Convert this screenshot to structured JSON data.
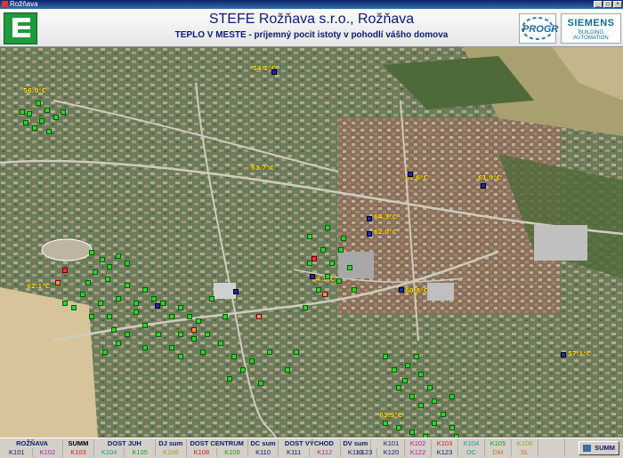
{
  "window": {
    "title": "Rožňava"
  },
  "header": {
    "title": "STEFE Rožňava s.r.o., Rožňava",
    "subtitle": "TEPLO V MESTE - príjemný pocit istoty v pohodlí vášho domova",
    "logo_left": "E",
    "logo_mid": "PROGR",
    "logo_right_brand": "SIEMENS",
    "logo_right_sub": "BUILDING AUTOMATION"
  },
  "map": {
    "labels": [
      {
        "text": "56.0°C"
      },
      {
        "text": "54.2°C"
      },
      {
        "text": "63.7°C"
      },
      {
        "text": "62.6°C"
      },
      {
        "text": "61.9°C"
      },
      {
        "text": "64.3°C"
      },
      {
        "text": "62.0°C"
      },
      {
        "text": "64.1°C"
      },
      {
        "text": "60.8°C"
      },
      {
        "text": "57.1°C"
      },
      {
        "text": "63.5°C"
      },
      {
        "text": "62.1°C"
      }
    ]
  },
  "nav": {
    "row1": [
      "ROŽŇAVA",
      "",
      "SUMM",
      "DOST JUH",
      "DJ sum",
      "DOST CENTRUM",
      "DC sum",
      "DOST VÝCHOD",
      "DV sum"
    ],
    "row2": [
      "K101",
      "K102",
      "K103",
      "K104",
      "K105",
      "K106",
      "K108",
      "K109",
      "K110",
      "K111",
      "K112",
      "K113",
      "K123"
    ],
    "right_row1": [
      "K101",
      "K102",
      "K103",
      "K104",
      "K105",
      "K106",
      ""
    ],
    "right_row2": [
      "K120",
      "K122",
      "K123",
      "OC",
      "DM",
      "SL",
      ""
    ],
    "summ_button": "SUMM"
  },
  "colors": {
    "title": "#0a1a78",
    "marker_ok": "#2bd42b",
    "marker_alarm": "#e33333",
    "temperature_label": "#ffe000"
  }
}
